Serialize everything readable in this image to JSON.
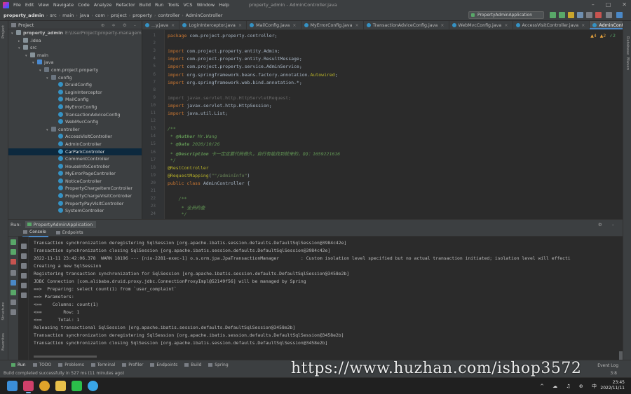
{
  "menu": {
    "items": [
      "File",
      "Edit",
      "View",
      "Navigate",
      "Code",
      "Analyze",
      "Refactor",
      "Build",
      "Run",
      "Tools",
      "VCS",
      "Window",
      "Help"
    ],
    "window_title": "property_admin - AdminController.java"
  },
  "breadcrumb": [
    "property_admin",
    "src",
    "main",
    "java",
    "com",
    "project",
    "property",
    "controller",
    "AdminController"
  ],
  "run_config": "PropertyAdminApplication",
  "project_panel": {
    "title": "Project",
    "tree": [
      {
        "indent": 0,
        "arrow": "▾",
        "icon": "folder",
        "label": "property_admin",
        "hint": "E:\\UserProject\\property-management"
      },
      {
        "indent": 1,
        "arrow": "▸",
        "icon": "folder",
        "label": ".idea",
        "hint": ""
      },
      {
        "indent": 1,
        "arrow": "▾",
        "icon": "folder",
        "label": "src",
        "hint": ""
      },
      {
        "indent": 2,
        "arrow": "▾",
        "icon": "folder",
        "label": "main",
        "hint": ""
      },
      {
        "indent": 3,
        "arrow": "▾",
        "icon": "src",
        "label": "java",
        "hint": ""
      },
      {
        "indent": 4,
        "arrow": "▾",
        "icon": "pkg",
        "label": "com.project.property",
        "hint": ""
      },
      {
        "indent": 5,
        "arrow": "▾",
        "icon": "pkg",
        "label": "config",
        "hint": ""
      },
      {
        "indent": 6,
        "arrow": "",
        "icon": "cls",
        "label": "DruidConfig",
        "hint": ""
      },
      {
        "indent": 6,
        "arrow": "",
        "icon": "cls",
        "label": "LoginInterceptor",
        "hint": ""
      },
      {
        "indent": 6,
        "arrow": "",
        "icon": "cls",
        "label": "MailConfig",
        "hint": ""
      },
      {
        "indent": 6,
        "arrow": "",
        "icon": "cls",
        "label": "MyErrorConfig",
        "hint": ""
      },
      {
        "indent": 6,
        "arrow": "",
        "icon": "cls",
        "label": "TransactionAdviceConfig",
        "hint": ""
      },
      {
        "indent": 6,
        "arrow": "",
        "icon": "cls",
        "label": "WebMvcConfig",
        "hint": ""
      },
      {
        "indent": 5,
        "arrow": "▾",
        "icon": "pkg",
        "label": "controller",
        "hint": ""
      },
      {
        "indent": 6,
        "arrow": "",
        "icon": "cls",
        "label": "AccessVisitController",
        "hint": ""
      },
      {
        "indent": 6,
        "arrow": "",
        "icon": "cls",
        "label": "AdminController",
        "hint": ""
      },
      {
        "indent": 6,
        "arrow": "",
        "icon": "cls",
        "label": "CarParkController",
        "hint": "",
        "selected": true
      },
      {
        "indent": 6,
        "arrow": "",
        "icon": "cls",
        "label": "CommentController",
        "hint": ""
      },
      {
        "indent": 6,
        "arrow": "",
        "icon": "cls",
        "label": "HouseInfoController",
        "hint": ""
      },
      {
        "indent": 6,
        "arrow": "",
        "icon": "cls",
        "label": "MyErrorPageController",
        "hint": ""
      },
      {
        "indent": 6,
        "arrow": "",
        "icon": "cls",
        "label": "NoticeController",
        "hint": ""
      },
      {
        "indent": 6,
        "arrow": "",
        "icon": "cls",
        "label": "PropertyChargeItemController",
        "hint": ""
      },
      {
        "indent": 6,
        "arrow": "",
        "icon": "cls",
        "label": "PropertyChargeVisitController",
        "hint": ""
      },
      {
        "indent": 6,
        "arrow": "",
        "icon": "cls",
        "label": "PropertyPayVisitController",
        "hint": ""
      },
      {
        "indent": 6,
        "arrow": "",
        "icon": "cls",
        "label": "SystemController",
        "hint": ""
      }
    ]
  },
  "editor": {
    "tabs": [
      {
        "label": "...y.java",
        "active": false
      },
      {
        "label": "LoginInterceptor.java",
        "active": false
      },
      {
        "label": "MailConfig.java",
        "active": false
      },
      {
        "label": "MyErrorConfig.java",
        "active": false
      },
      {
        "label": "TransactionAdviceConfig.java",
        "active": false
      },
      {
        "label": "WebMvcConfig.java",
        "active": false
      },
      {
        "label": "AccessVisitController.java",
        "active": false
      },
      {
        "label": "AdminController.java",
        "active": true
      }
    ],
    "inspections": {
      "warnings": "▲4",
      "weak": "▲2",
      "ok": "✓2"
    },
    "lines": [
      {
        "n": "1",
        "html": "<span class=\"kw\">package</span> com.project.property.controller;"
      },
      {
        "n": "2",
        "html": ""
      },
      {
        "n": "3",
        "html": "<span class=\"kw\">import</span> com.project.property.entity.Admin;"
      },
      {
        "n": "4",
        "html": "<span class=\"kw\">import</span> com.project.property.entity.ResultMessage;"
      },
      {
        "n": "5",
        "html": "<span class=\"kw\">import</span> com.project.property.service.AdminService;"
      },
      {
        "n": "6",
        "html": "<span class=\"kw\">import</span> org.springframework.beans.factory.annotation.<span class=\"ann\">Autowired</span>;"
      },
      {
        "n": "7",
        "html": "<span class=\"kw\">import</span> org.springframework.web.bind.annotation.*;"
      },
      {
        "n": "8",
        "html": ""
      },
      {
        "n": "9",
        "html": "<span class=\"dim\">import javax.servlet.http.HttpServletRequest;</span>"
      },
      {
        "n": "10",
        "html": "<span class=\"kw\">import</span> javax.servlet.http.HttpSession;"
      },
      {
        "n": "11",
        "html": "<span class=\"kw\">import</span> java.util.List;"
      },
      {
        "n": "12",
        "html": ""
      },
      {
        "n": "13",
        "html": "<span class=\"doc\">/**</span>"
      },
      {
        "n": "14",
        "html": "<span class=\"doc\"> * </span><span class=\"doct\">@Author</span><span class=\"doc\"> Mr.Wang</span>"
      },
      {
        "n": "15",
        "html": "<span class=\"doc\"> * </span><span class=\"doct\">@Date</span><span class=\"doc\"> 2020/10/26</span>"
      },
      {
        "n": "16",
        "html": "<span class=\"doc\"> * </span><span class=\"doct\">@Description</span><span class=\"doc\"> 卡一定这要代码做久，自行有能找到就来的，QQ：1659221616</span>"
      },
      {
        "n": "17",
        "html": "<span class=\"doc\"> */</span>"
      },
      {
        "n": "18",
        "html": "<span class=\"ann\">@RestController</span>"
      },
      {
        "n": "19",
        "html": "<span class=\"ann\">@RequestMapping</span>(<span class=\"str\">\"\"/adminInfo\"</span>)"
      },
      {
        "n": "20",
        "html": "<span class=\"kw\">public class</span> AdminController {"
      },
      {
        "n": "21",
        "html": ""
      },
      {
        "n": "22",
        "html": "    <span class=\"doc\">/**</span>"
      },
      {
        "n": "23",
        "html": "    <span class=\"doc\"> * 全员的查</span>"
      },
      {
        "n": "24",
        "html": "    <span class=\"doc\"> */</span>"
      }
    ]
  },
  "run_panel": {
    "label": "Run:",
    "tab": "PropertyAdminApplication",
    "subtabs": [
      "Console",
      "Endpoints"
    ],
    "console": [
      "Transaction synchronization deregistering SqlSession [org.apache.ibatis.session.defaults.DefaultSqlSession@3984c42e]",
      "Transaction synchronization closing SqlSession [org.apache.ibatis.session.defaults.DefaultSqlSession@3984c42e]",
      "2022-11-11 23:42:06.378  WARN 18196 --- [nio-2281-exec-1] o.s.orm.jpa.JpaTransactionManager        : Custom isolation level specified but no actual transaction initiated; isolation level will effecti",
      "Creating a new SqlSession",
      "Registering transaction synchronization for SqlSession [org.apache.ibatis.session.defaults.DefaultSqlSession@3458e2b]",
      "JDBC Connection [com.alibaba.druid.proxy.jdbc.ConnectionProxyImpl@52149f56] will be managed by Spring",
      "==>  Preparing: select count(1) from `user_complaint`",
      "==> Parameters: ",
      "<==    Columns: count(1)",
      "<==        Row: 1",
      "<==      Total: 1",
      "Releasing transactional SqlSession [org.apache.ibatis.session.defaults.DefaultSqlSession@3458e2b]",
      "Transaction synchronization deregistering SqlSession [org.apache.ibatis.session.defaults.DefaultSqlSession@3458e2b]",
      "Transaction synchronization closing SqlSession [org.apache.ibatis.session.defaults.DefaultSqlSession@3458e2b]"
    ]
  },
  "bottom_tools": [
    "Run",
    "TODO",
    "Problems",
    "Terminal",
    "Profiler",
    "Endpoints",
    "Build",
    "Spring"
  ],
  "event_log": "Event Log",
  "status_message": "Build completed successfully in 527 ms (11 minutes ago)",
  "status_right": "3:8",
  "side_labels": {
    "project": "Project",
    "structure": "Structure",
    "favorites": "Favorites",
    "database": "Database",
    "maven": "Maven"
  },
  "taskbar": {
    "time": "23:45",
    "date": "2022/11/11",
    "tray": "^ ☁ ♫ ⊕ 中"
  },
  "watermark": "https://www.huzhan.com/ishop3572"
}
